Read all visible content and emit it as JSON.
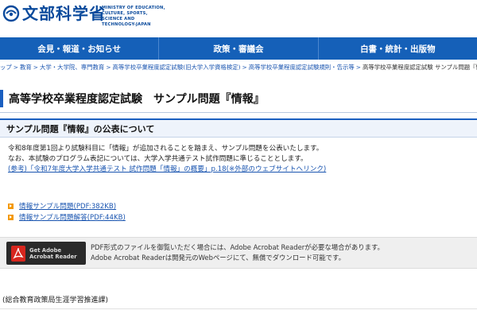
{
  "header": {
    "logo_kanji": "文部科学省",
    "logo_en": "MINISTRY OF EDUCATION,\nCULTURE, SPORTS,\nSCIENCE AND TECHNOLOGY-JAPAN",
    "brand_color": "#0a4a9c"
  },
  "nav": {
    "items": [
      "会見・報道・お知らせ",
      "政策・審議会",
      "白書・統計・出版物"
    ],
    "bg_color": "#1560b8"
  },
  "breadcrumb": {
    "items": [
      "ップ",
      "教育",
      "大学・大学院、専門教育",
      "高等学校卒業程度認定試験(旧大学入学資格検定)",
      "高等学校卒業程度認定試験規則・告示等"
    ],
    "current": "高等学校卒業程度認定試験 サンプル問題『情'"
  },
  "page": {
    "title": "高等学校卒業程度認定試験　サンプル問題『情報』",
    "section_heading": "サンプル問題『情報』の公表について",
    "paragraph1": "令和8年度第1回より試験科目に「情報」が追加されることを踏まえ、サンプル問題を公表いたします。",
    "paragraph2": "なお、本試験のプログラム表記については、大学入学共通テスト試作問題に準じることとします。",
    "reference_link": "(参考)「令和7年度大学入学共通テスト 試作問題「情報」の概要」p.18(※外部のウェブサイトへリンク)"
  },
  "downloads": [
    {
      "label": "情報サンプル問題(PDF:382KB)"
    },
    {
      "label": "情報サンプル問題解答(PDF:44KB)"
    }
  ],
  "acrobat": {
    "badge_label": "Get Adobe\nAcrobat Reader",
    "line1": "PDF形式のファイルを御覧いただく場合には、Adobe Acrobat Readerが必要な場合があります。",
    "line2": "Adobe Acrobat Readerは開発元のWebページにて、無償でダウンロード可能です。"
  },
  "footer": {
    "department": "(総合教育政策局生涯学習推進課)"
  }
}
